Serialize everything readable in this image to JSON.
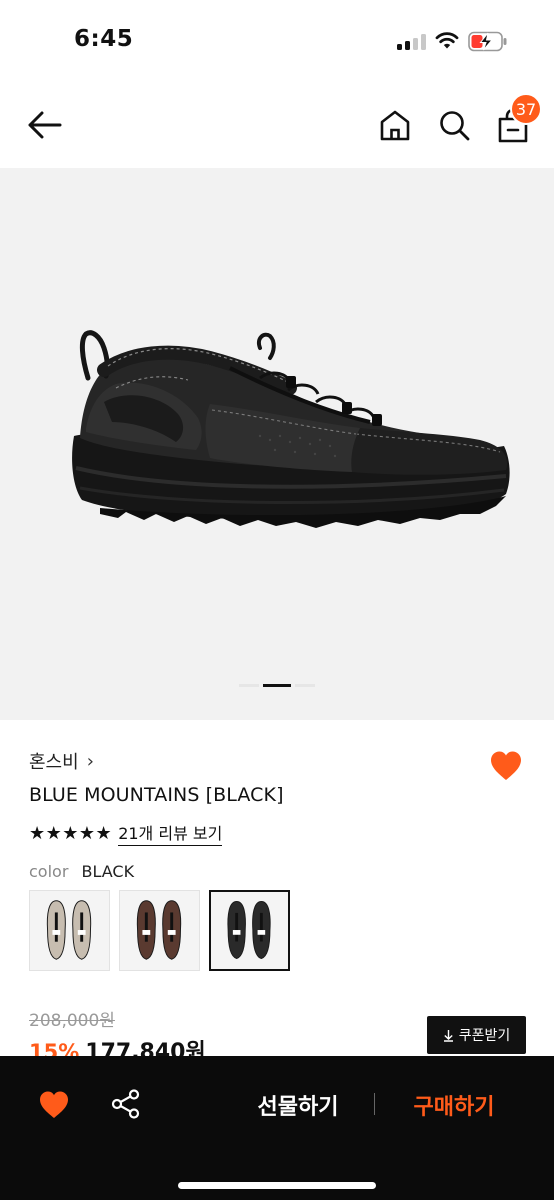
{
  "status_bar": {
    "time": "6:45"
  },
  "nav": {
    "cart_count": "37"
  },
  "hero": {
    "image": "black-hiking-sneaker-photo",
    "pager": {
      "count": 3,
      "active": 1
    }
  },
  "product": {
    "brand": "혼스비",
    "brand_chevron": "›",
    "name": "BLUE MOUNTAINS [BLACK]",
    "rating": {
      "stars_text": "★★★★★",
      "stars": 5,
      "review_link": "21개 리뷰 보기"
    },
    "color_label": "color",
    "color_value": "BLACK",
    "color_options": [
      {
        "name": "beige",
        "shoe_color": "#c7bdb0",
        "selected": false
      },
      {
        "name": "brown",
        "shoe_color": "#5a3a30",
        "selected": false
      },
      {
        "name": "black",
        "shoe_color": "#2a2a2a",
        "selected": true
      }
    ],
    "original_price": "208,000원",
    "discount": "15%",
    "price": "177,840원",
    "coupon_button": "쿠폰받기",
    "coupon_icon": "download-arrow-icon"
  },
  "bottom_bar": {
    "gift_label": "선물하기",
    "buy_label": "구매하기"
  },
  "colors": {
    "accent": "#ff5b1a",
    "bottom_bar_bg": "#0b0b0b",
    "hero_bg": "#f2f2f2"
  }
}
